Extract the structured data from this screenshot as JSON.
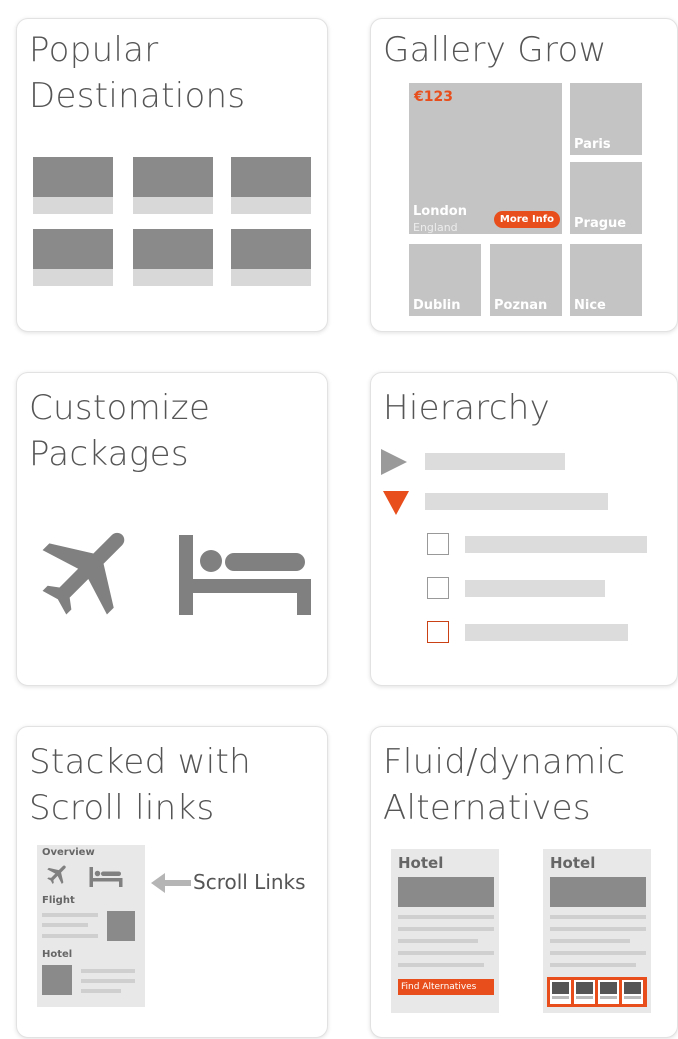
{
  "cards": {
    "popular": {
      "title": "Popular\nDestinations"
    },
    "gallery": {
      "title": "Gallery Grow",
      "price": "€123",
      "main_city": "London",
      "main_country": "England",
      "more_info": "More Info",
      "tiles": [
        "Paris",
        "Prague",
        "Dublin",
        "Poznan",
        "Nice"
      ]
    },
    "customize": {
      "title": "Customize\nPackages",
      "icons": [
        "airplane-icon",
        "bed-icon"
      ]
    },
    "hierarchy": {
      "title": "Hierarchy",
      "icons": [
        "triangle-right-icon",
        "triangle-down-icon",
        "checkbox-icon"
      ]
    },
    "stacked": {
      "title": "Stacked with\nScroll links",
      "overview": "Overview",
      "flight": "Flight",
      "hotel": "Hotel",
      "scroll_links": "Scroll Links"
    },
    "fluid": {
      "title": "Fluid/dynamic\nAlternatives",
      "hotel_a": "Hotel",
      "hotel_b": "Hotel",
      "find_alternatives": "Find Alternatives"
    }
  },
  "colors": {
    "accent": "#e84e1b",
    "gray_dark": "#8a8a8a",
    "gray_light": "#d8d8d8"
  }
}
